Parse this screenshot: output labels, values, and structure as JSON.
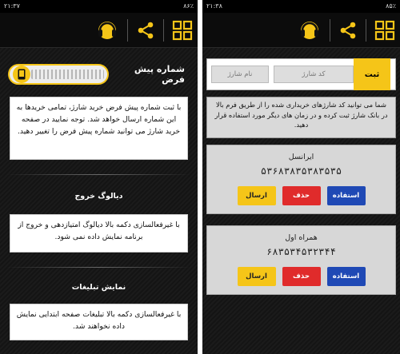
{
  "left_screen": {
    "status": {
      "time": "۲۱:۳۷",
      "battery": "۸۶٪"
    },
    "default_label": "شماره پیش فرض",
    "default_note": "با ثبت شماره پیش فرض خرید شارژ، تمامی خریدها به این شماره ارسال خواهد شد. توجه نمایید در صفحه خرید شارژ می توانید شماره پیش فرض را تغییر دهید.",
    "dialog_heading": "دیالوگ خروج",
    "dialog_note": "با غیرفعالسازی دکمه بالا دیالوگ امتیازدهی و خروج از برنامه نمایش داده نمی شود.",
    "ads_heading": "نمایش تبلیغات",
    "ads_note": "با غیرفعالسازی دکمه بالا تبلیغات صفحه ابتدایی نمایش داده نخواهند شد."
  },
  "right_screen": {
    "status": {
      "time": "۲۱:۳۸",
      "battery": "۸۵٪"
    },
    "submit_label": "ثبت",
    "code_placeholder": "کد شارژ",
    "name_placeholder": "نام شارژ",
    "info": "شما می توانید کد شارژهای خریداری شده را از طریق فرم بالا در بانک شارژ ثبت کرده و در زمان های دیگر مورد استفاده قرار دهید.",
    "cards": [
      {
        "operator": "ایرانسل",
        "code": "۵۳۶۸۳۸۳۵۳۸۳۵۳۵",
        "use": "استفاده",
        "delete": "حذف",
        "send": "ارسال"
      },
      {
        "operator": "همراه اول",
        "code": "۶۸۳۵۳۴۵۳۲۳۴۴",
        "use": "استفاده",
        "delete": "حذف",
        "send": "ارسال"
      }
    ]
  },
  "icons": [
    "grid-icon",
    "share-icon",
    "headset-icon",
    "phone-icon"
  ],
  "colors": {
    "accent": "#f5c518",
    "delete": "#e02b2b",
    "use": "#1f49b5"
  }
}
